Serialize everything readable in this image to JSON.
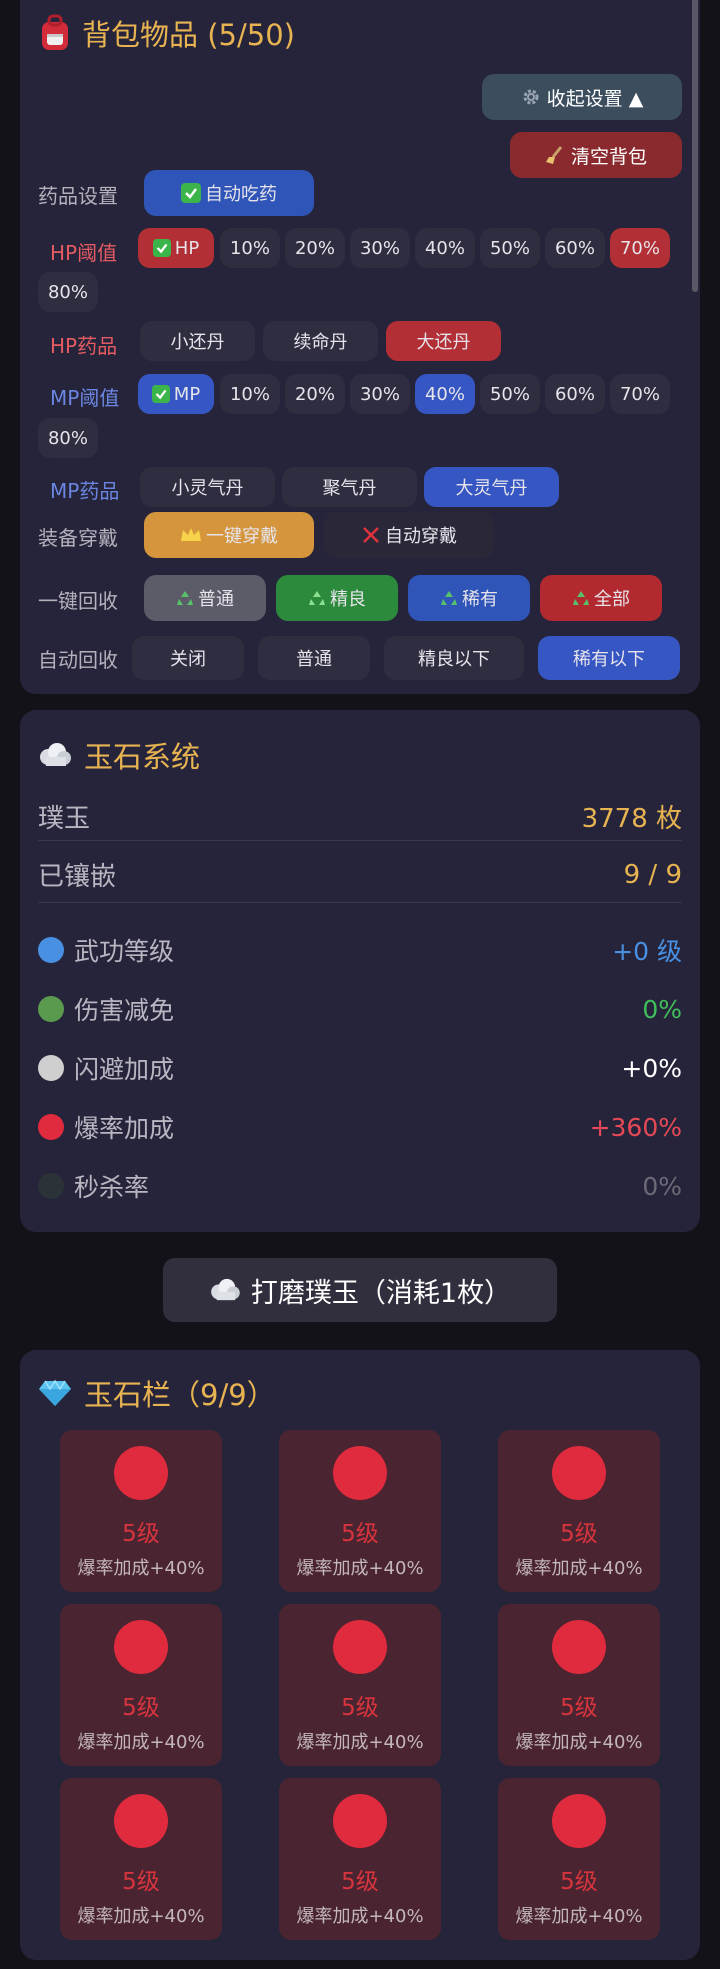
{
  "bag": {
    "title": "背包物品 (5/50)",
    "collapse_label": "收起设置 ▲",
    "clear_label": "清空背包",
    "rows": {
      "medicine": {
        "label": "药品设置",
        "auto_eat": "自动吃药"
      },
      "hp_threshold": {
        "label": "HP阈值",
        "toggle": "HP",
        "options": [
          "10%",
          "20%",
          "30%",
          "40%",
          "50%",
          "60%",
          "70%",
          "80%"
        ],
        "selected": "70%"
      },
      "hp_potion": {
        "label": "HP药品",
        "options": [
          "小还丹",
          "续命丹",
          "大还丹"
        ],
        "selected": "大还丹"
      },
      "mp_threshold": {
        "label": "MP阈值",
        "toggle": "MP",
        "options": [
          "10%",
          "20%",
          "30%",
          "40%",
          "50%",
          "60%",
          "70%",
          "80%"
        ],
        "selected": "40%"
      },
      "mp_potion": {
        "label": "MP药品",
        "options": [
          "小灵气丹",
          "聚气丹",
          "大灵气丹"
        ],
        "selected": "大灵气丹"
      },
      "equip": {
        "label": "装备穿戴",
        "one_click": "一键穿戴",
        "auto": "自动穿戴"
      },
      "recycle": {
        "label": "一键回收",
        "options": [
          "普通",
          "精良",
          "稀有",
          "全部"
        ]
      },
      "auto_recycle": {
        "label": "自动回收",
        "options": [
          "关闭",
          "普通",
          "精良以下",
          "稀有以下"
        ],
        "selected": "稀有以下"
      }
    }
  },
  "jade": {
    "title": "玉石系统",
    "pu_label": "璞玉",
    "pu_value": "3778 枚",
    "inlaid_label": "已镶嵌",
    "inlaid_value": "9 / 9",
    "stats": [
      {
        "label": "武功等级",
        "value": "+0 级",
        "dot": "#4a90e2",
        "color": "#4a90e2"
      },
      {
        "label": "伤害减免",
        "value": "0%",
        "dot": "#5a9a4e",
        "color": "#3fbf58"
      },
      {
        "label": "闪避加成",
        "value": "+0%",
        "dot": "#cfcfcf",
        "color": "#ffffff"
      },
      {
        "label": "爆率加成",
        "value": "+360%",
        "dot": "#e02a3e",
        "color": "#e64955"
      },
      {
        "label": "秒杀率",
        "value": "0%",
        "dot": "#2b3338",
        "color": "#6c6a76"
      }
    ]
  },
  "polish_label": "打磨璞玉（消耗1枚）",
  "slots": {
    "title": "玉石栏（9/9）",
    "items": [
      {
        "level": "5级",
        "effect": "爆率加成+40%"
      },
      {
        "level": "5级",
        "effect": "爆率加成+40%"
      },
      {
        "level": "5级",
        "effect": "爆率加成+40%"
      },
      {
        "level": "5级",
        "effect": "爆率加成+40%"
      },
      {
        "level": "5级",
        "effect": "爆率加成+40%"
      },
      {
        "level": "5级",
        "effect": "爆率加成+40%"
      },
      {
        "level": "5级",
        "effect": "爆率加成+40%"
      },
      {
        "level": "5级",
        "effect": "爆率加成+40%"
      },
      {
        "level": "5级",
        "effect": "爆率加成+40%"
      }
    ]
  }
}
